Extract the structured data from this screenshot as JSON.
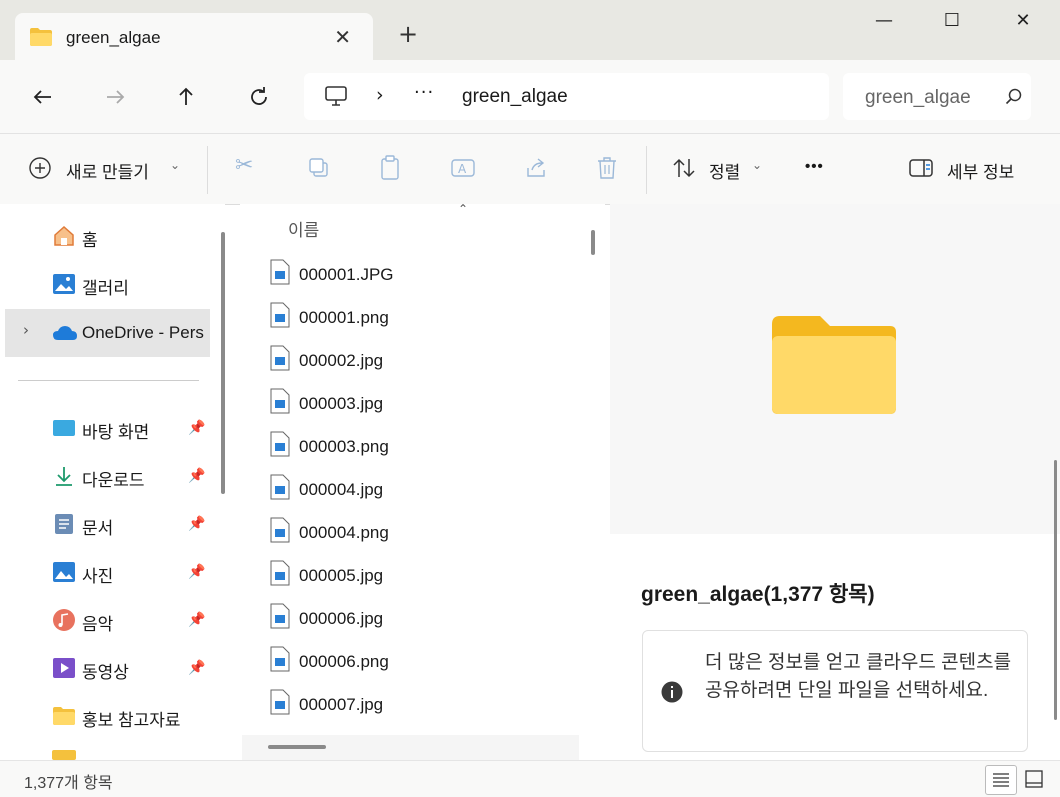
{
  "tab": {
    "title": "green_algae"
  },
  "window_controls": {
    "minimize": "—",
    "maximize": "☐",
    "close": "✕"
  },
  "address": {
    "ellipsis": "···",
    "path": "green_algae"
  },
  "search": {
    "text": "green_algae"
  },
  "toolbar": {
    "new_label": "새로 만들기",
    "sort_label": "정렬",
    "more_label": "•••",
    "details_label": "세부 정보"
  },
  "sidebar": {
    "home": "홈",
    "gallery": "갤러리",
    "onedrive": "OneDrive - Pers",
    "quick": [
      {
        "label": "바탕 화면",
        "pinned": true
      },
      {
        "label": "다운로드",
        "pinned": true
      },
      {
        "label": "문서",
        "pinned": true
      },
      {
        "label": "사진",
        "pinned": true
      },
      {
        "label": "음악",
        "pinned": true
      },
      {
        "label": "동영상",
        "pinned": true
      },
      {
        "label": "홍보 참고자료",
        "pinned": false
      }
    ]
  },
  "filelist": {
    "column_header": "이름",
    "files": [
      "000001.JPG",
      "000001.png",
      "000002.jpg",
      "000003.jpg",
      "000003.png",
      "000004.jpg",
      "000004.png",
      "000005.jpg",
      "000006.jpg",
      "000006.png",
      "000007.jpg"
    ]
  },
  "details": {
    "title": "green_algae(1,377 항목)",
    "info": "더 많은 정보를 얻고 클라우드 콘텐츠를 공유하려면 단일 파일을 선택하세요."
  },
  "status": {
    "count": "1,377개 항목"
  },
  "colors": {
    "folder": "#f4c13d",
    "onedrive": "#1e7bd9",
    "selected_row": "#e5e5e5"
  }
}
